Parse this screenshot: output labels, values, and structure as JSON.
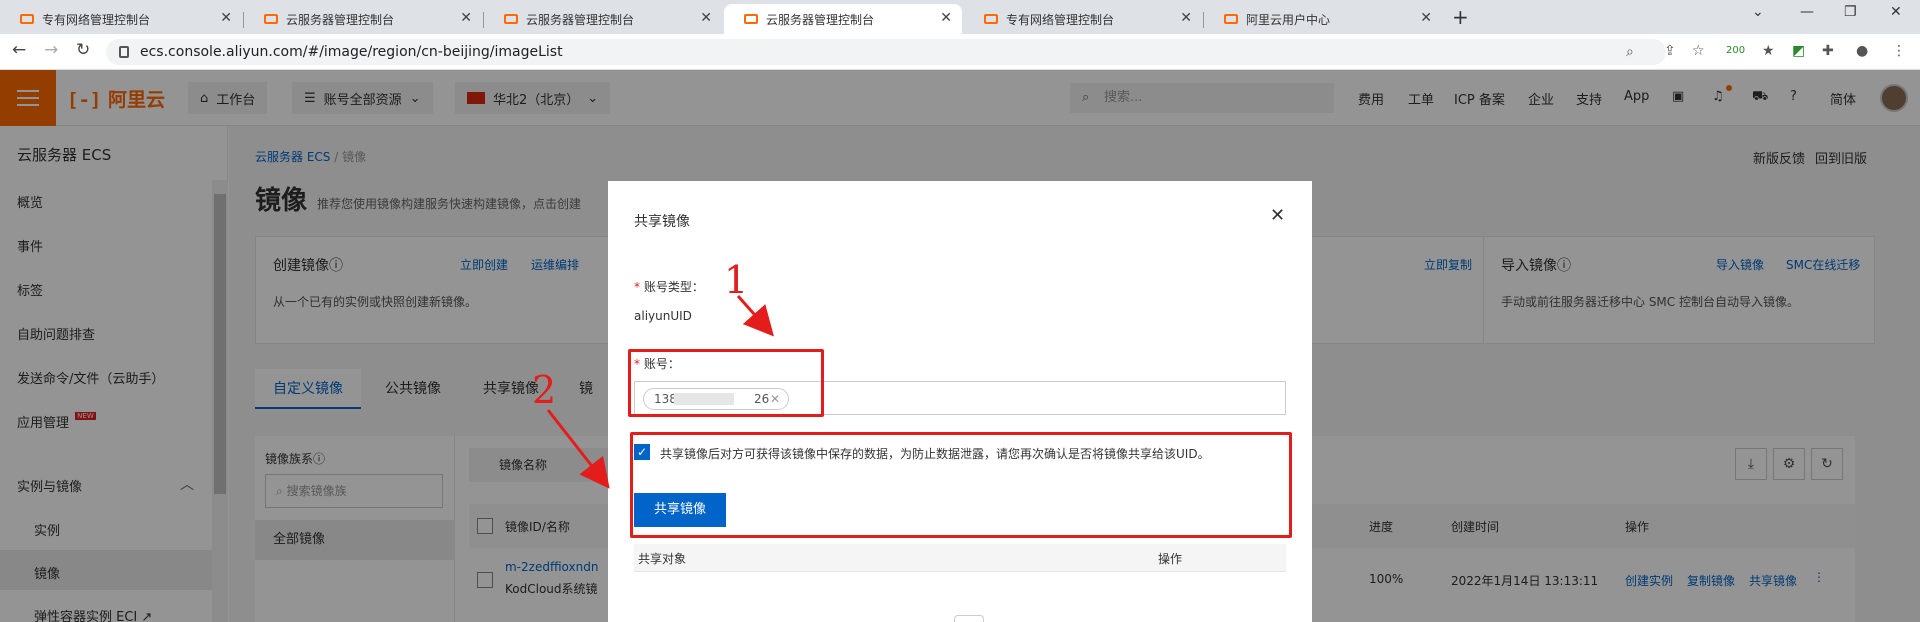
{
  "browser": {
    "tabs": [
      {
        "title": "专有网络管理控制台",
        "active": false
      },
      {
        "title": "云服务器管理控制台",
        "active": false
      },
      {
        "title": "云服务器管理控制台",
        "active": false
      },
      {
        "title": "云服务器管理控制台",
        "active": true
      },
      {
        "title": "专有网络管理控制台",
        "active": false
      },
      {
        "title": "阿里云用户中心",
        "active": false
      }
    ],
    "url": "ecs.console.aliyun.com/#/image/region/cn-beijing/imageList",
    "ext_badge": "200"
  },
  "topnav": {
    "logo": "阿里云",
    "workbench": "工作台",
    "resources": "账号全部资源",
    "region": "华北2（北京）",
    "search_placeholder": "搜索...",
    "links": [
      "费用",
      "工单",
      "ICP 备案",
      "企业",
      "支持",
      "App"
    ],
    "lang": "简体"
  },
  "sidebar": {
    "title": "云服务器 ECS",
    "items": [
      "概览",
      "事件",
      "标签",
      "自助问题排查",
      "发送命令/文件（云助手）",
      "应用管理"
    ],
    "new_badge": "NEW",
    "group": "实例与镜像",
    "sub_items": [
      "实例",
      "镜像",
      "弹性容器实例 ECI"
    ]
  },
  "main": {
    "breadcrumb": [
      "云服务器 ECS",
      "镜像"
    ],
    "title": "镜像",
    "description": "推荐您使用镜像构建服务快速构建镜像，点击创建",
    "top_links": [
      "新版反馈",
      "回到旧版"
    ],
    "create_card": {
      "title": "创建镜像",
      "desc": "从一个已有的实例或快照创建新镜像。",
      "links": [
        "立即创建",
        "运维编排"
      ]
    },
    "copy_link": "立即复制",
    "import_card": {
      "title": "导入镜像",
      "desc": "手动或前往服务器迁移中心 SMC 控制台自动导入镜像。",
      "links": [
        "导入镜像",
        "SMC在线迁移"
      ]
    },
    "tabs": [
      "自定义镜像",
      "公共镜像",
      "共享镜像",
      "镜"
    ],
    "filter": {
      "label": "镜像族系",
      "placeholder": "搜索镜像族",
      "all": "全部镜像"
    },
    "name_select": "镜像名称",
    "table": {
      "headers": [
        "镜像ID/名称",
        "进度",
        "创建时间",
        "操作"
      ],
      "row": {
        "id": "m-2zedffioxndn",
        "name": "KodCloud系统镜",
        "progress": "100%",
        "created": "2022年1月14日 13:13:11",
        "actions": [
          "创建实例",
          "复制镜像",
          "共享镜像"
        ]
      }
    }
  },
  "modal": {
    "title": "共享镜像",
    "account_type_label": "账号类型：",
    "account_type_value": "aliyunUID",
    "account_label": "账号：",
    "account_chip_prefix": "138",
    "account_chip_suffix": "26",
    "confirm_text": "共享镜像后对方可获得该镜像中保存的数据，为防止数据泄露，请您再次确认是否将镜像共享给该UID。",
    "share_button": "共享镜像",
    "share_table_headers": [
      "共享对象",
      "操作"
    ]
  },
  "annotations": [
    "1",
    "2"
  ],
  "colors": {
    "brand": "#ff6a00",
    "primary": "#0064c8",
    "annotation": "#e31c1c"
  }
}
